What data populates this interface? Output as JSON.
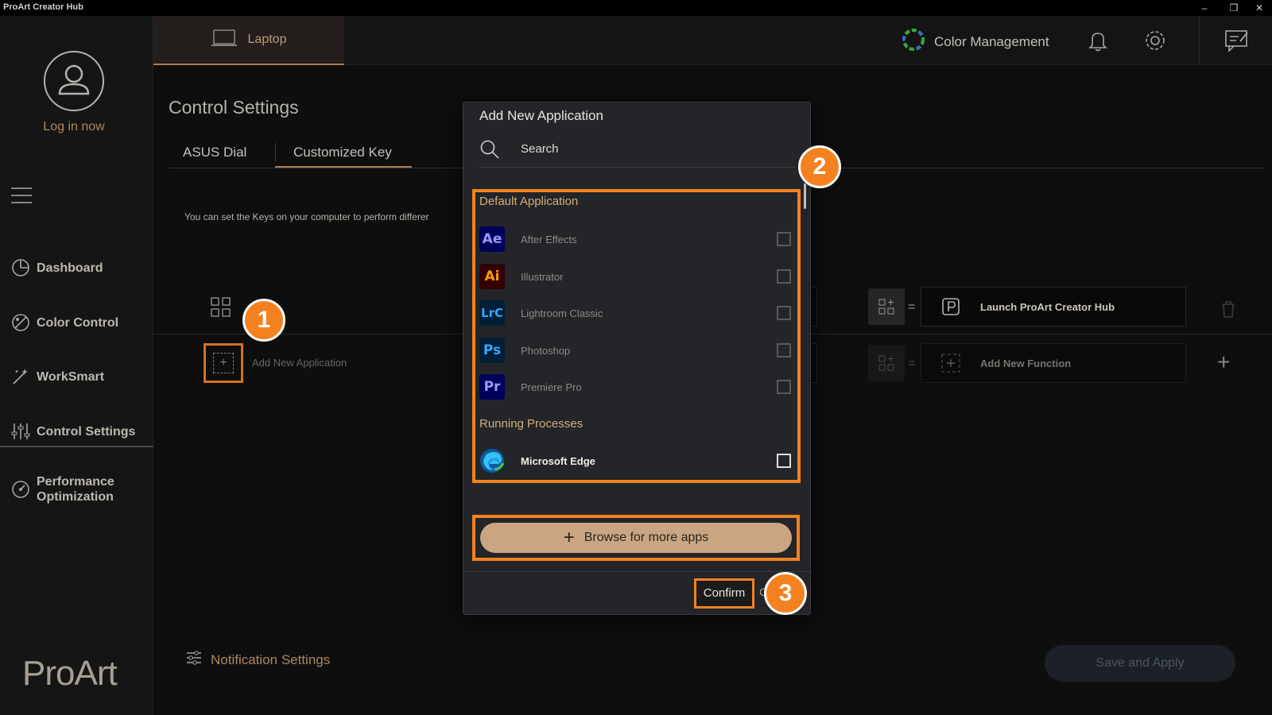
{
  "window": {
    "title": "ProArt Creator Hub",
    "minimize": "–",
    "maximize": "❐",
    "close": "✕"
  },
  "sidebar": {
    "login_label": "Log in now",
    "items": [
      {
        "label": "Dashboard",
        "icon": "dashboard-icon"
      },
      {
        "label": "Color Control",
        "icon": "color-control-icon"
      },
      {
        "label": "WorkSmart",
        "icon": "worksmart-icon"
      },
      {
        "label": "Control Settings",
        "icon": "control-settings-icon"
      },
      {
        "label": "Performance Optimization",
        "icon": "performance-icon"
      }
    ],
    "brand": "ProArt"
  },
  "topbar": {
    "device_tab": "Laptop",
    "color_management": "Color Management"
  },
  "main": {
    "title": "Control Settings",
    "tabs": [
      "ASUS Dial",
      "Customized Key"
    ],
    "active_tab": "Customized Key",
    "hint": "You can set the Keys on your computer  to perform differer",
    "add_new_application": "Add New Application",
    "functions": [
      {
        "label": "Launch ProArt Creator Hub"
      },
      {
        "label": "Add New Function"
      }
    ],
    "equals": "=",
    "notification_settings": "Notification Settings",
    "save_apply": "Save and Apply"
  },
  "dialog": {
    "title": "Add New Application",
    "search_placeholder": "Search",
    "default_section": "Default Application",
    "default_apps": [
      {
        "label": "After Effects",
        "abbr": "Ae",
        "bg": "#00005b",
        "fg": "#9999ff",
        "checked": false
      },
      {
        "label": "Illustrator",
        "abbr": "Ai",
        "bg": "#330000",
        "fg": "#ff9a00",
        "checked": false
      },
      {
        "label": "Lightroom Classic",
        "abbr": "LrC",
        "bg": "#001e36",
        "fg": "#31a8ff",
        "checked": false
      },
      {
        "label": "Photoshop",
        "abbr": "Ps",
        "bg": "#001e36",
        "fg": "#31a8ff",
        "checked": false
      },
      {
        "label": "Premiere Pro",
        "abbr": "Pr",
        "bg": "#00005b",
        "fg": "#9999ff",
        "checked": false
      }
    ],
    "running_section": "Running Processes",
    "running_apps": [
      {
        "label": "Microsoft Edge",
        "checked": false
      }
    ],
    "browse_label": "Browse for more apps",
    "confirm_label": "Confirm",
    "cancel_stub": "C"
  },
  "markers": [
    "1",
    "2",
    "3"
  ],
  "colors": {
    "accent": "#f4811f",
    "gold": "#c79a6a",
    "browse": "#c9a681"
  }
}
